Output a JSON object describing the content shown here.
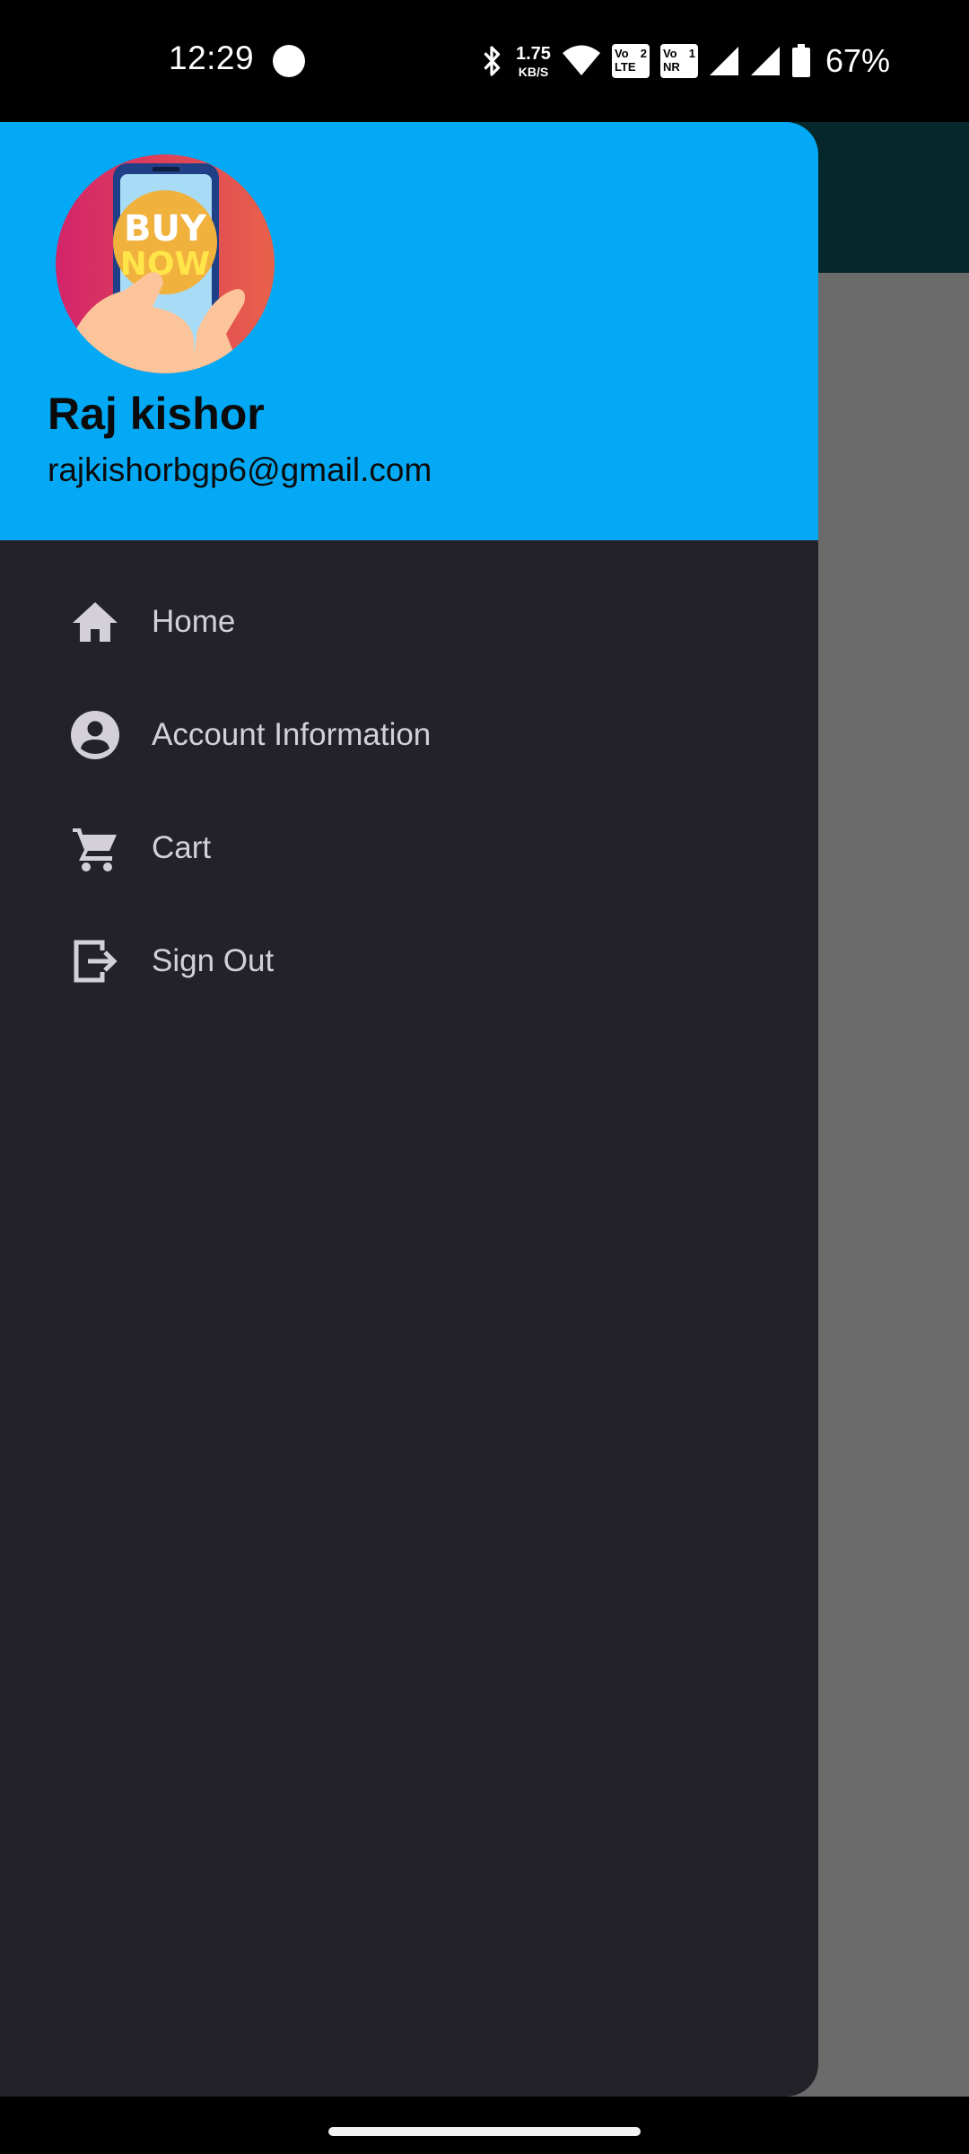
{
  "status_bar": {
    "time": "12:29",
    "net_speed_value": "1.75",
    "net_speed_unit": "KB/S",
    "sim1_badge": {
      "top_left": "Vo",
      "top_right": "2",
      "bottom": "LTE"
    },
    "sim2_badge": {
      "top_left": "Vo",
      "top_right": "1",
      "bottom": "NR"
    },
    "battery_percent": "67%",
    "icons": [
      "notification-dot-icon",
      "bluetooth-icon",
      "wifi-icon",
      "signal-icon",
      "signal-icon",
      "battery-icon"
    ]
  },
  "drawer": {
    "header": {
      "avatar_text": [
        "BUY",
        "NOW"
      ],
      "user_name": "Raj kishor",
      "user_email": "rajkishorbgp6@gmail.com"
    },
    "menu": [
      {
        "label": "Home",
        "icon": "home-icon"
      },
      {
        "label": "Account Information",
        "icon": "account-circle-icon"
      },
      {
        "label": "Cart",
        "icon": "cart-icon"
      },
      {
        "label": "Sign Out",
        "icon": "sign-out-icon"
      }
    ]
  },
  "colors": {
    "header_bg": "#03a9f4",
    "drawer_bg": "#232228",
    "scrim": "#6b6b6b",
    "app_bar": "#06282a",
    "menu_text": "#d4d0da"
  }
}
